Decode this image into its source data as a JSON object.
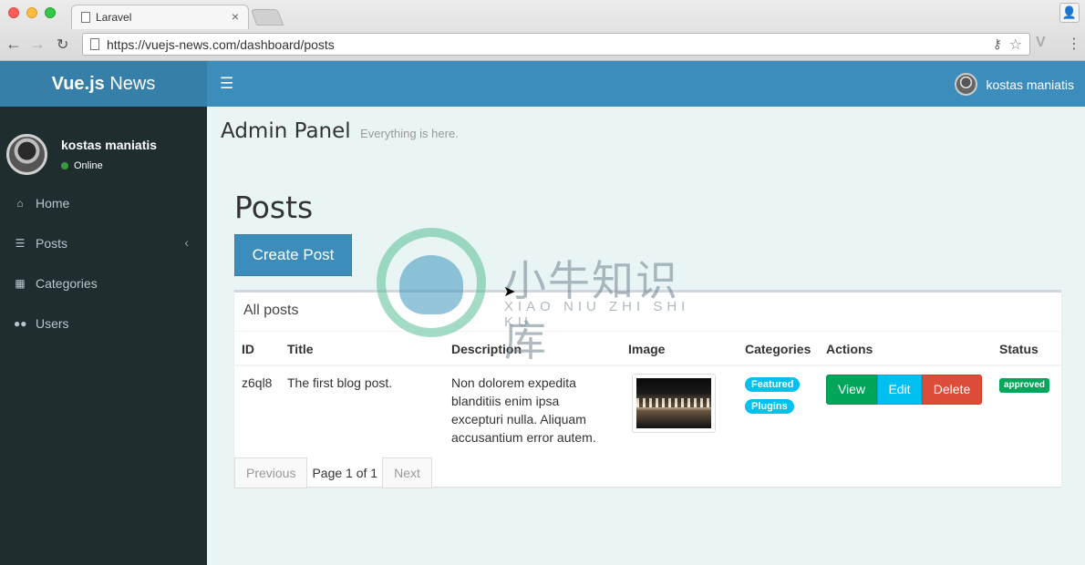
{
  "browser": {
    "tab_title": "Laravel",
    "tab_close": "×",
    "url": "https://vuejs-news.com/dashboard/posts"
  },
  "app": {
    "logo_bold": "Vue.js",
    "logo_light": " News",
    "header_user": "kostas maniatis"
  },
  "sidebar": {
    "user_name": "kostas maniatis",
    "user_status": "Online",
    "items": [
      {
        "label": "Home",
        "icon": "home-icon"
      },
      {
        "label": "Posts",
        "icon": "list-icon"
      },
      {
        "label": "Categories",
        "icon": "th-large-icon"
      },
      {
        "label": "Users",
        "icon": "users-icon"
      }
    ]
  },
  "header": {
    "title": "Admin Panel",
    "subtitle": "Everything is here."
  },
  "main": {
    "heading": "Posts",
    "create_label": "Create Post",
    "box_title": "All posts",
    "columns": [
      "ID",
      "Title",
      "Description",
      "Image",
      "Categories",
      "Actions",
      "Status"
    ],
    "rows": [
      {
        "id": "z6ql8",
        "title": "The first blog post.",
        "description": "Non dolorem expedita blanditiis enim ipsa excepturi nulla. Aliquam accusantium error autem.",
        "categories": [
          "Featured",
          "Plugins"
        ],
        "actions": {
          "view": "View",
          "edit": "Edit",
          "delete": "Delete"
        },
        "status": "approved"
      }
    ],
    "pagination": {
      "previous": "Previous",
      "info": "Page 1 of 1",
      "next": "Next"
    }
  },
  "watermark": {
    "chinese": "小牛知识库",
    "pinyin": "XIAO NIU ZHI SHI KU"
  },
  "colors": {
    "primary": "#3c8dbc",
    "logo_bg": "#367fa9",
    "sidebar_bg": "#1f2d2f",
    "success": "#00a65a",
    "info": "#00c0ef",
    "danger": "#dd4b39"
  }
}
